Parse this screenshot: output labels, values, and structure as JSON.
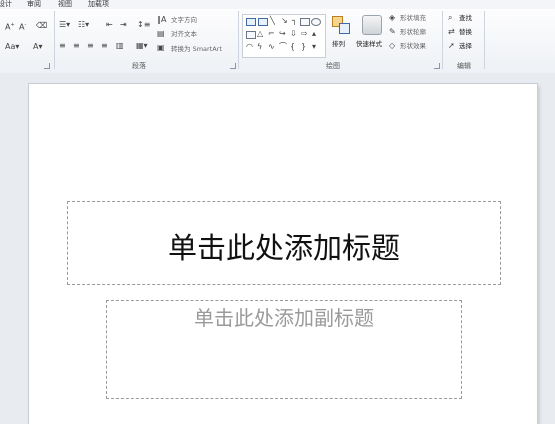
{
  "tabs": {
    "left": "设计",
    "review": "审阅",
    "view": "视图",
    "addins": "加载项"
  },
  "paragraph": {
    "group_label": "段落",
    "text_direction": "文字方向",
    "align_text": "对齐文本",
    "convert_smartart": "转换为 SmartArt"
  },
  "drawing": {
    "group_label": "绘图",
    "arrange": "排列",
    "quick_styles": "快速样式",
    "shape_fill": "形状填充",
    "shape_outline": "形状轮廓",
    "shape_effects": "形状效果"
  },
  "editing": {
    "group_label": "编辑",
    "find": "查找",
    "replace": "替换",
    "select": "选择"
  },
  "slide": {
    "title_placeholder": "单击此处添加标题",
    "subtitle_placeholder": "单击此处添加副标题"
  }
}
